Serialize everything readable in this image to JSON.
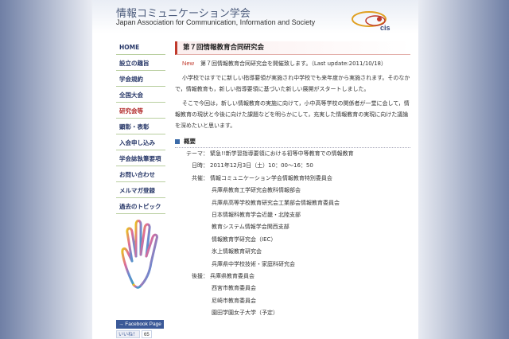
{
  "header": {
    "title": "情報コミュニケーション学会",
    "subtitle": "Japan Association for Communication, Information and Society",
    "logo_text": "cis"
  },
  "sidebar": {
    "items": [
      {
        "label": "HOME"
      },
      {
        "label": "設立の趣旨"
      },
      {
        "label": "学会規約"
      },
      {
        "label": "全国大会"
      },
      {
        "label": "研究会等"
      },
      {
        "label": "顕彰・表彰"
      },
      {
        "label": "入会申し込み"
      },
      {
        "label": "学会誌執筆要項"
      },
      {
        "label": "お問い合わせ"
      },
      {
        "label": "メルマガ登録"
      },
      {
        "label": "過去のトピック"
      }
    ],
    "active_index": 4,
    "facebook_label": "→ Facebook Page",
    "like_label": "いいね！",
    "like_count": "65"
  },
  "main": {
    "heading": "第７回情報教育合同研究会",
    "new_label": "New",
    "notice": "第７回情報教育合同研究会を開催致します。（Last update:2011/10/18）",
    "para1": "小学校ではすでに新しい指導要領が実施され中学校でも来年度から実施されます。そのなかで，情報教育も，新しい指導要領に基づいた新しい展開がスタートしました。",
    "para2": "そこで今回は，新しい情報教育の実施に向けて，小中高等学校の関係者が一堂に会して，情報教育の現状と今後に向けた課題などを明らかにして，充実した情報教育の実現に向けた議論を深めたいと思います。",
    "summary_heading": "概要",
    "theme_label": "テーマ：",
    "theme_value": "緊急!!新学習指導要領における初等中等教育での情報教育",
    "date_label": "日時：",
    "date_value": "2011年12月3日（土）10：00〜16：50",
    "cohost_label": "共催：",
    "cohosts": [
      "情報コミュニケーション学会情報教育特別委員会",
      "兵庫県教育工学研究会教科情報部会",
      "兵庫県高等学校教育研究会工業部会情報教育委員会",
      "日本情報科教育学会近畿・北陸支部",
      "教育システム情報学会関西支部",
      "情報教育学研究会（IEC）",
      "氷上情報教育研究会",
      "兵庫県中学校技術・家庭科研究会"
    ],
    "support_label": "後援：",
    "supporters": [
      "兵庫県教育委員会",
      "西宮市教育委員会",
      "尼崎市教育委員会",
      "園田学園女子大学（予定）"
    ]
  },
  "colors": {
    "accent_red": "#c0392b",
    "nav_blue": "#2a3a6a",
    "facebook_blue": "#3b5998"
  }
}
